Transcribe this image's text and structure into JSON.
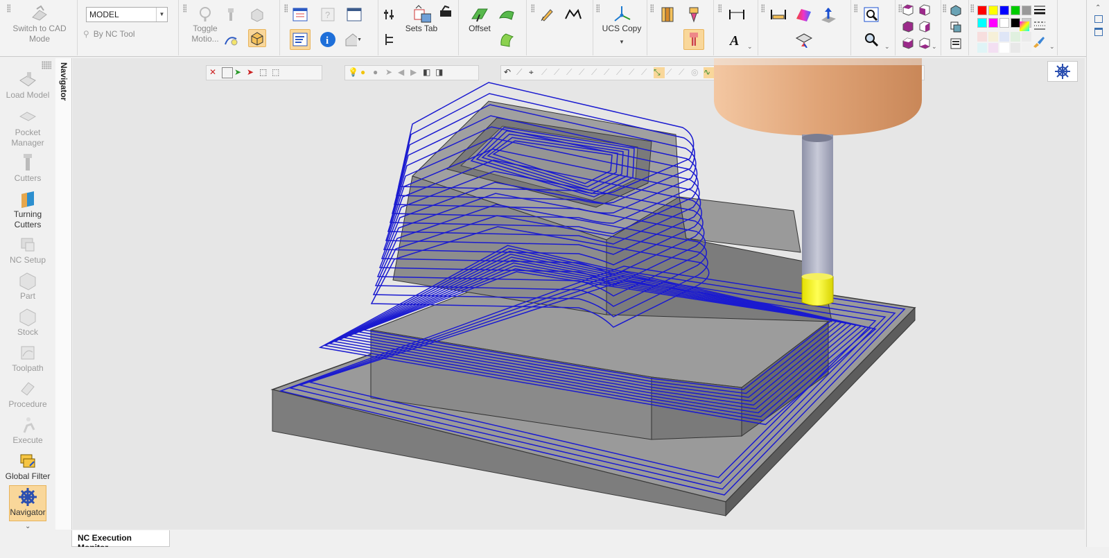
{
  "ribbon": {
    "switch_cad": "Switch to CAD Mode",
    "model_combo": "MODEL",
    "by_nc_tool": "By NC Tool",
    "toggle_motion": "Toggle Motio...",
    "sets_tab": "Sets Tab",
    "offset": "Offset",
    "ucs_copy": "UCS Copy"
  },
  "sidebar": {
    "items": [
      {
        "label": "Load Model",
        "icon": "load-model-icon"
      },
      {
        "label": "Pocket Manager",
        "icon": "pocket-manager-icon"
      },
      {
        "label": "Cutters",
        "icon": "cutters-icon"
      },
      {
        "label": "Turning Cutters",
        "icon": "turning-cutters-icon"
      },
      {
        "label": "NC Setup",
        "icon": "nc-setup-icon"
      },
      {
        "label": "Part",
        "icon": "part-icon"
      },
      {
        "label": "Stock",
        "icon": "stock-icon"
      },
      {
        "label": "Toolpath",
        "icon": "toolpath-icon"
      },
      {
        "label": "Procedure",
        "icon": "procedure-icon"
      },
      {
        "label": "Execute",
        "icon": "execute-icon"
      },
      {
        "label": "Global Filter",
        "icon": "global-filter-icon"
      },
      {
        "label": "Navigator",
        "icon": "navigator-icon"
      }
    ]
  },
  "navigator_tab": "Navigator",
  "bottom_tab": "NC Execution Monitor",
  "colors": {
    "accent": "#f9d79a",
    "toolpath": "#1a1ad0",
    "part": "#8a8a8a",
    "tool_holder": "#e2a477",
    "tool_tip": "#f1ef1c"
  },
  "palette": [
    "#ff0000",
    "#ffff00",
    "#0000ff",
    "#00cc00",
    "#999999",
    "#00ffff",
    "#ff00ff",
    "#ffffff",
    "#000000",
    "#cccccc"
  ]
}
